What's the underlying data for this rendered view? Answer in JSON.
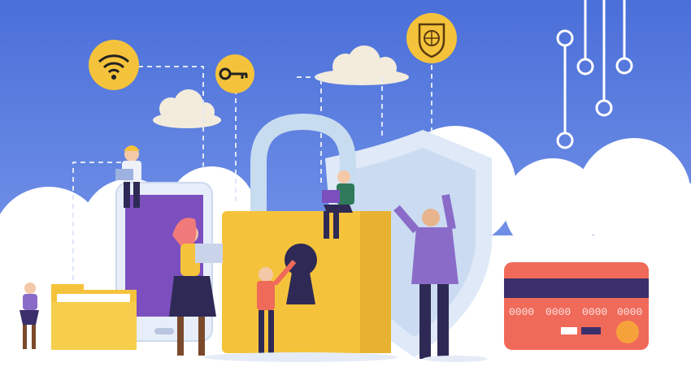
{
  "illustration": {
    "card_number_groups": [
      "0000",
      "0000",
      "0000",
      "0000"
    ]
  },
  "colors": {
    "sky_top": "#4a6fd8",
    "sky_bottom": "#7f9ef0",
    "cloud": "#ffffff",
    "gold": "#f5c33b",
    "gold_dark": "#e0a82c",
    "lock_shackle": "#c8dcf0",
    "shield": "#dfe9f7",
    "phone_screen": "#7c4fbf",
    "card": "#f06a5a",
    "card_stripe": "#3b2f6b",
    "person_dark": "#2e2a55"
  },
  "icons": [
    "wifi-icon",
    "key-icon",
    "shield-globe-icon",
    "padlock-icon",
    "shield-icon",
    "smartphone-icon",
    "folder-icon",
    "credit-card-icon",
    "circuit-icon"
  ]
}
